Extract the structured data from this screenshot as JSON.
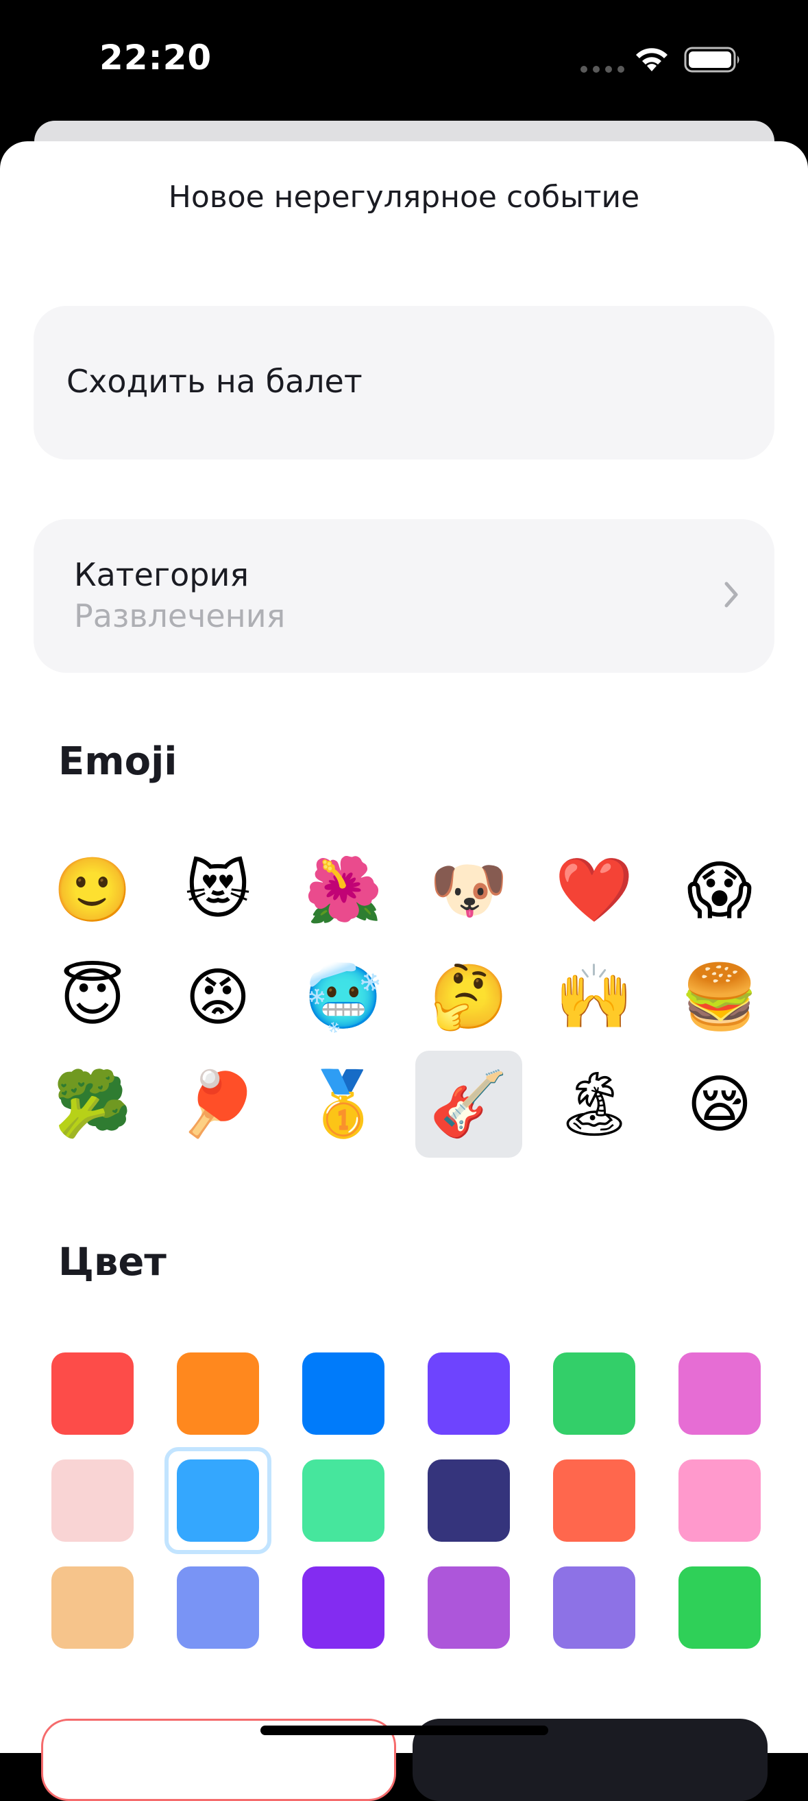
{
  "status_bar": {
    "time": "22:20"
  },
  "header": {
    "title": "Новое нерегулярное событие"
  },
  "name_field": {
    "value": "Сходить на балет"
  },
  "category": {
    "label": "Категория",
    "value": "Развлечения"
  },
  "emoji_section": {
    "title": "Emoji",
    "items": [
      "🙂",
      "😻",
      "🌺",
      "🐶",
      "❤️",
      "😱",
      "😇",
      "😡",
      "🥶",
      "🤔",
      "🙌",
      "🍔",
      "🥦",
      "🏓",
      "🥇",
      "🎸",
      "🏝",
      "😪"
    ],
    "selected_index": 15
  },
  "color_section": {
    "title": "Цвет",
    "colors": [
      "#fd4c49",
      "#ff881e",
      "#007bfa",
      "#6e44fe",
      "#33cf69",
      "#e66dd4",
      "#f9d4d4",
      "#34a7fe",
      "#46e69d",
      "#35347c",
      "#ff674d",
      "#ff99cc",
      "#f6c48b",
      "#7994f5",
      "#832cf1",
      "#ad56da",
      "#8d72e6",
      "#2fd058"
    ],
    "selected_index": 7
  },
  "buttons": {
    "cancel_label": "",
    "create_label": ""
  }
}
